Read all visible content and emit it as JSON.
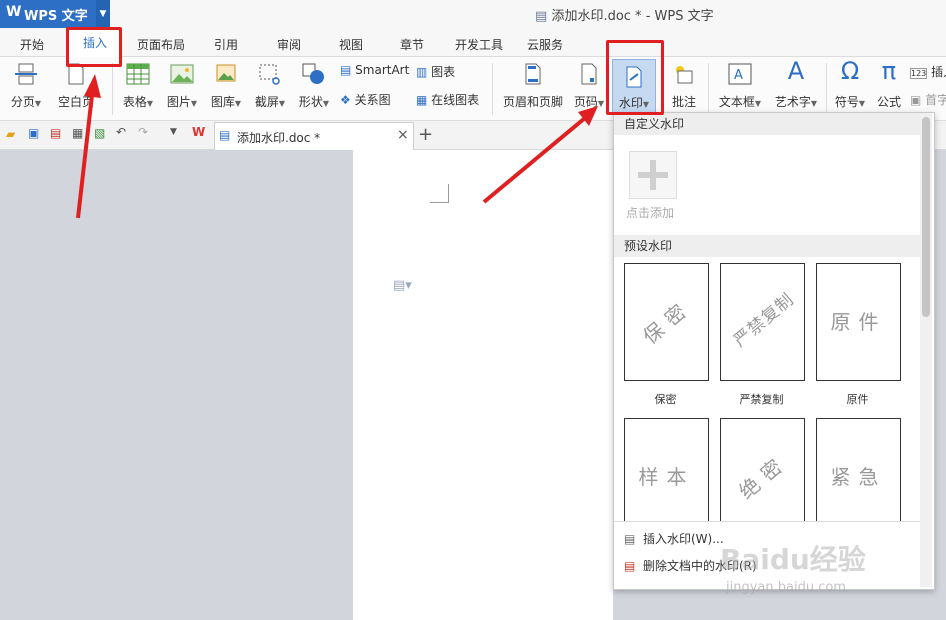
{
  "app": {
    "logo": "W",
    "name": "WPS 文字",
    "doc_title": "添加水印.doc * - WPS 文字"
  },
  "tabs": [
    "开始",
    "插入",
    "页面布局",
    "引用",
    "审阅",
    "视图",
    "章节",
    "开发工具",
    "云服务"
  ],
  "ribbon": {
    "page_break": "分页",
    "blank_page": "空白页",
    "table": "表格",
    "picture": "图片",
    "gallery": "图库",
    "screenshot": "截屏",
    "shape": "形状",
    "smartart": "SmartArt",
    "chart": "图表",
    "relation": "关系图",
    "online_chart": "在线图表",
    "header_footer": "页眉和页脚",
    "page_number": "页码",
    "watermark": "水印",
    "comment": "批注",
    "textbox": "文本框",
    "wordart": "艺术字",
    "symbol": "符号",
    "formula": "公式",
    "insert_num": "插入",
    "first_char": "首字"
  },
  "doc_tab": {
    "name": "添加水印.doc *",
    "close": "×",
    "add": "+"
  },
  "panel": {
    "custom_title": "自定义水印",
    "add_label": "点击添加",
    "preset_title": "预设水印",
    "presets": [
      {
        "text": "保密",
        "label": "保密"
      },
      {
        "text": "严禁复制",
        "label": "严禁复制"
      },
      {
        "text": "原件",
        "label": "原件"
      },
      {
        "text": "样本",
        "label": ""
      },
      {
        "text": "绝密",
        "label": ""
      },
      {
        "text": "紧急",
        "label": ""
      }
    ],
    "insert_watermark": "插入水印(W)...",
    "remove_watermark": "删除文档中的水印(R)"
  },
  "overlay": {
    "brand": "Baidu经验",
    "url": "jingyan.baidu.com"
  },
  "colors": {
    "accent": "#2d6fc4",
    "highlight": "#e02020"
  }
}
